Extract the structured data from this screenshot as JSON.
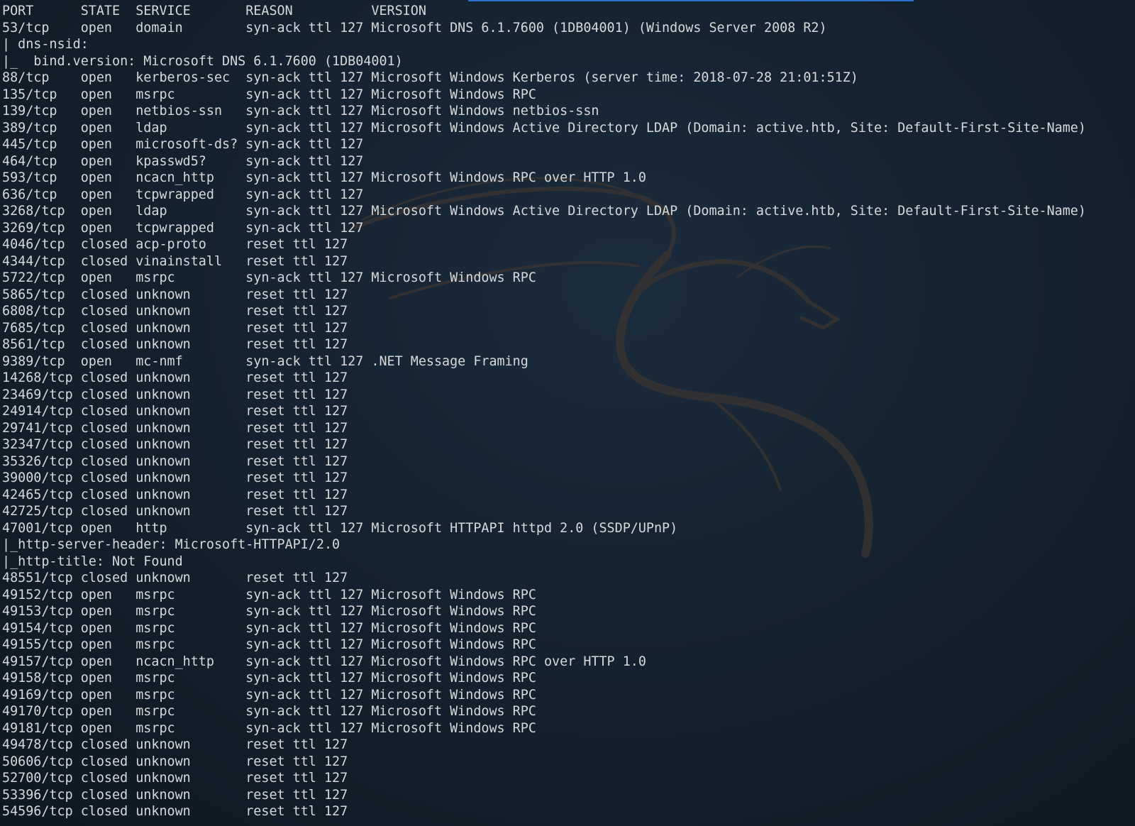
{
  "terminal": {
    "header": "PORT      STATE  SERVICE       REASON          VERSION",
    "lines": [
      "53/tcp    open   domain        syn-ack ttl 127 Microsoft DNS 6.1.7600 (1DB04001) (Windows Server 2008 R2)",
      "| dns-nsid:",
      "|_  bind.version: Microsoft DNS 6.1.7600 (1DB04001)",
      "88/tcp    open   kerberos-sec  syn-ack ttl 127 Microsoft Windows Kerberos (server time: 2018-07-28 21:01:51Z)",
      "135/tcp   open   msrpc         syn-ack ttl 127 Microsoft Windows RPC",
      "139/tcp   open   netbios-ssn   syn-ack ttl 127 Microsoft Windows netbios-ssn",
      "389/tcp   open   ldap          syn-ack ttl 127 Microsoft Windows Active Directory LDAP (Domain: active.htb, Site: Default-First-Site-Name)",
      "445/tcp   open   microsoft-ds? syn-ack ttl 127",
      "464/tcp   open   kpasswd5?     syn-ack ttl 127",
      "593/tcp   open   ncacn_http    syn-ack ttl 127 Microsoft Windows RPC over HTTP 1.0",
      "636/tcp   open   tcpwrapped    syn-ack ttl 127",
      "3268/tcp  open   ldap          syn-ack ttl 127 Microsoft Windows Active Directory LDAP (Domain: active.htb, Site: Default-First-Site-Name)",
      "3269/tcp  open   tcpwrapped    syn-ack ttl 127",
      "4046/tcp  closed acp-proto     reset ttl 127",
      "4344/tcp  closed vinainstall   reset ttl 127",
      "5722/tcp  open   msrpc         syn-ack ttl 127 Microsoft Windows RPC",
      "5865/tcp  closed unknown       reset ttl 127",
      "6808/tcp  closed unknown       reset ttl 127",
      "7685/tcp  closed unknown       reset ttl 127",
      "8561/tcp  closed unknown       reset ttl 127",
      "9389/tcp  open   mc-nmf        syn-ack ttl 127 .NET Message Framing",
      "14268/tcp closed unknown       reset ttl 127",
      "23469/tcp closed unknown       reset ttl 127",
      "24914/tcp closed unknown       reset ttl 127",
      "29741/tcp closed unknown       reset ttl 127",
      "32347/tcp closed unknown       reset ttl 127",
      "35326/tcp closed unknown       reset ttl 127",
      "39000/tcp closed unknown       reset ttl 127",
      "42465/tcp closed unknown       reset ttl 127",
      "42725/tcp closed unknown       reset ttl 127",
      "47001/tcp open   http          syn-ack ttl 127 Microsoft HTTPAPI httpd 2.0 (SSDP/UPnP)",
      "|_http-server-header: Microsoft-HTTPAPI/2.0",
      "|_http-title: Not Found",
      "48551/tcp closed unknown       reset ttl 127",
      "49152/tcp open   msrpc         syn-ack ttl 127 Microsoft Windows RPC",
      "49153/tcp open   msrpc         syn-ack ttl 127 Microsoft Windows RPC",
      "49154/tcp open   msrpc         syn-ack ttl 127 Microsoft Windows RPC",
      "49155/tcp open   msrpc         syn-ack ttl 127 Microsoft Windows RPC",
      "49157/tcp open   ncacn_http    syn-ack ttl 127 Microsoft Windows RPC over HTTP 1.0",
      "49158/tcp open   msrpc         syn-ack ttl 127 Microsoft Windows RPC",
      "49169/tcp open   msrpc         syn-ack ttl 127 Microsoft Windows RPC",
      "49170/tcp open   msrpc         syn-ack ttl 127 Microsoft Windows RPC",
      "49181/tcp open   msrpc         syn-ack ttl 127 Microsoft Windows RPC",
      "49478/tcp closed unknown       reset ttl 127",
      "50606/tcp closed unknown       reset ttl 127",
      "52700/tcp closed unknown       reset ttl 127",
      "53396/tcp closed unknown       reset ttl 127",
      "54596/tcp closed unknown       reset ttl 127"
    ]
  },
  "colors": {
    "text": "#d6d9dc",
    "background": "#15222f",
    "accent": "#2f6fd0"
  },
  "icons": {
    "watermark": "kali-dragon-icon"
  }
}
